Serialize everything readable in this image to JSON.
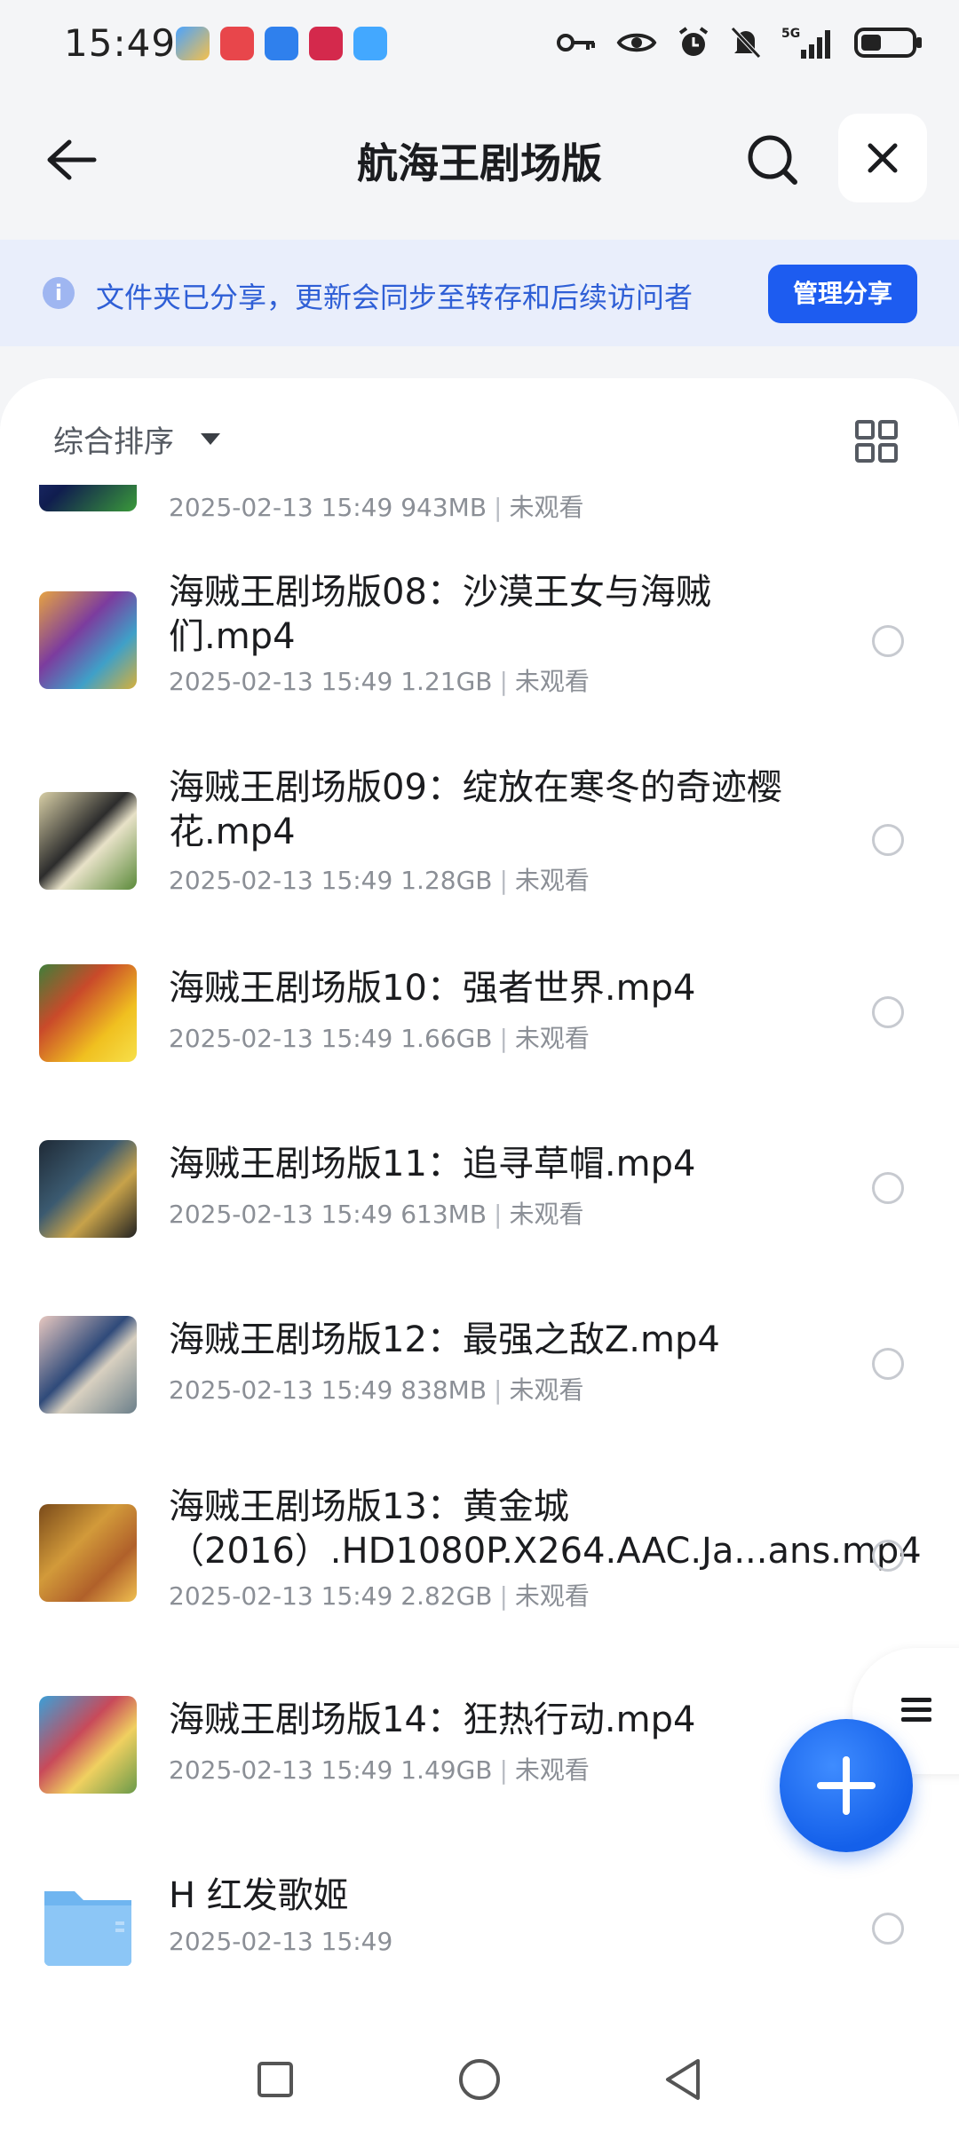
{
  "status_bar": {
    "time": "15:49",
    "network": "5G",
    "icons": [
      "key-icon",
      "eye-icon",
      "alarm-icon",
      "mute-icon",
      "signal-icon",
      "battery-icon"
    ]
  },
  "header": {
    "title": "航海王剧场版",
    "icons": [
      "back-arrow-icon",
      "search-icon",
      "close-icon"
    ]
  },
  "share_banner": {
    "text": "文件夹已分享，更新会同步至转存和后续访问者",
    "button_label": "管理分享",
    "info_icon": "i"
  },
  "sort": {
    "label": "综合排序"
  },
  "files": [
    {
      "name": "",
      "meta_date": "2025-02-13 15:49",
      "meta_size": "943MB",
      "meta_status": "未观看"
    },
    {
      "name": "海贼王剧场版08：沙漠王女与海贼们.mp4",
      "meta_date": "2025-02-13 15:49",
      "meta_size": "1.21GB",
      "meta_status": "未观看"
    },
    {
      "name": "海贼王剧场版09：绽放在寒冬的奇迹樱花.mp4",
      "meta_date": "2025-02-13 15:49",
      "meta_size": "1.28GB",
      "meta_status": "未观看"
    },
    {
      "name": "海贼王剧场版10：强者世界.mp4",
      "meta_date": "2025-02-13 15:49",
      "meta_size": "1.66GB",
      "meta_status": "未观看"
    },
    {
      "name": "海贼王剧场版11：追寻草帽.mp4",
      "meta_date": "2025-02-13 15:49",
      "meta_size": "613MB",
      "meta_status": "未观看"
    },
    {
      "name": "海贼王剧场版12：最强之敌Z.mp4",
      "meta_date": "2025-02-13 15:49",
      "meta_size": "838MB",
      "meta_status": "未观看"
    },
    {
      "name": "海贼王剧场版13：黄金城（2016）.HD1080P.X264.AAC.Ja...ans.mp4",
      "meta_date": "2025-02-13 15:49",
      "meta_size": "2.82GB",
      "meta_status": "未观看"
    },
    {
      "name": "海贼王剧场版14：狂热行动.mp4",
      "meta_date": "2025-02-13 15:49",
      "meta_size": "1.49GB",
      "meta_status": "未观看"
    },
    {
      "name": "H 红发歌姬",
      "meta_date": "2025-02-13 15:49",
      "meta_size": "",
      "meta_status": ""
    }
  ],
  "colors": {
    "accent": "#1d5cf0",
    "banner_bg": "#e9eefb",
    "banner_text": "#2f5fd6"
  }
}
